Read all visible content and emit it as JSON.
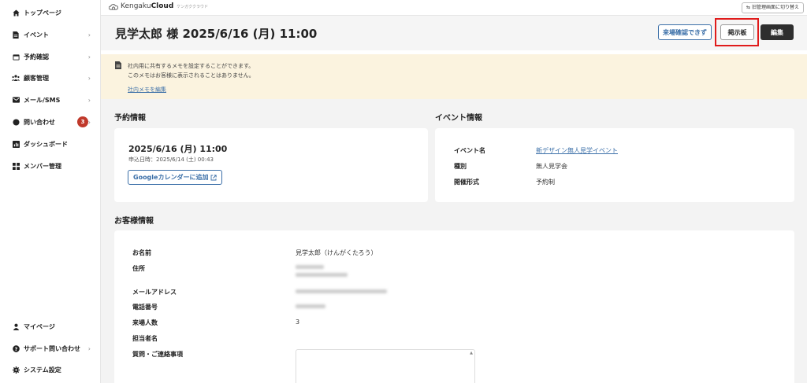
{
  "sidebar": {
    "items": [
      {
        "label": "トップページ",
        "icon": "home-icon"
      },
      {
        "label": "イベント",
        "icon": "document-icon",
        "chevron": "›"
      },
      {
        "label": "予約確認",
        "icon": "calendar-icon",
        "chevron": "›"
      },
      {
        "label": "顧客管理",
        "icon": "users-icon",
        "chevron": "›"
      },
      {
        "label": "メール/SMS",
        "icon": "mail-icon",
        "chevron": "›"
      },
      {
        "label": "問い合わせ",
        "icon": "chat-icon",
        "badge": "3",
        "chevron": "›"
      },
      {
        "label": "ダッシュボード",
        "icon": "chart-icon"
      },
      {
        "label": "メンバー管理",
        "icon": "grid-icon"
      }
    ],
    "bottom_items": [
      {
        "label": "マイページ",
        "icon": "user-icon"
      },
      {
        "label": "サポート問い合わせ",
        "icon": "help-icon",
        "chevron": "›"
      },
      {
        "label": "システム設定",
        "icon": "gear-icon"
      }
    ]
  },
  "topbar": {
    "logo_prefix": "Kengaku",
    "logo_bold": "Cloud",
    "logo_sub": "ケンガククラウド",
    "switch_label": "旧管理画面に切り替え"
  },
  "header": {
    "title": "見学太郎 様 2025/6/16 (月) 11:00",
    "visit_confirm_label": "来場確認できず",
    "board_label": "掲示板",
    "edit_label": "編集"
  },
  "memo": {
    "line1": "社内用に共有するメモを設定することができます。",
    "line2": "このメモはお客様に表示されることはありません。",
    "edit_link": "社内メモを編集"
  },
  "reservation": {
    "section_title": "予約情報",
    "date": "2025/6/16 (月) 11:00",
    "applied": "申込日時：2025/6/14 (土) 00:43",
    "gcal_label": "Googleカレンダーに追加"
  },
  "event": {
    "section_title": "イベント情報",
    "name_label": "イベント名",
    "name_value": "新デザイン無人見学イベント",
    "type_label": "種別",
    "type_value": "無人見学会",
    "format_label": "開催形式",
    "format_value": "予約制"
  },
  "customer": {
    "section_title": "お客様情報",
    "name_label": "お名前",
    "name_value": "見学太郎（けんがくたろう）",
    "address_label": "住所",
    "email_label": "メールアドレス",
    "phone_label": "電話番号",
    "visitors_label": "来場人数",
    "visitors_value": "3",
    "staff_label": "担当者名",
    "question_label": "質問・ご連絡事項"
  },
  "colors": {
    "accent": "#3b6fa8",
    "badge": "#c0392b",
    "highlight": "#e01b1b",
    "memo_bg": "#fbf3df"
  }
}
